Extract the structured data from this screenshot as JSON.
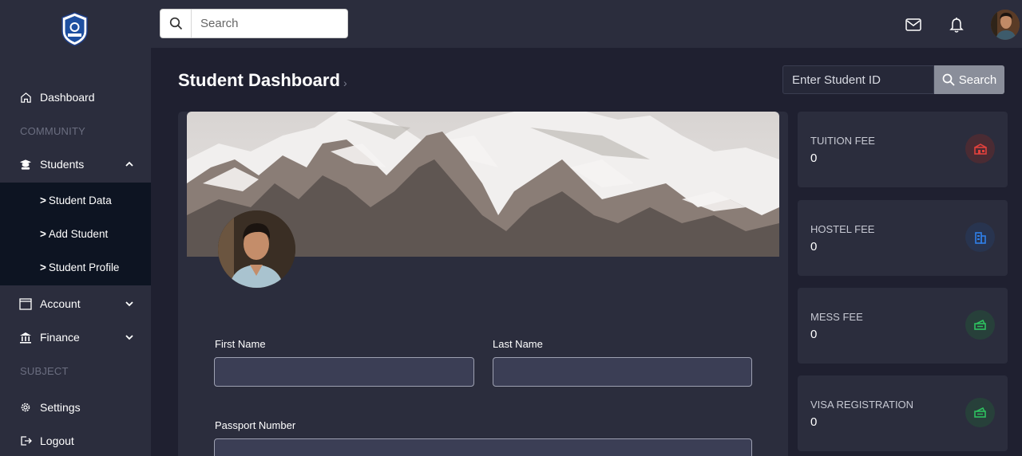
{
  "sidebar": {
    "items": {
      "dashboard": "Dashboard",
      "community": "COMMUNITY",
      "students": "Students",
      "student_data": "Student Data",
      "add_student": "Add Student",
      "student_profile": "Student Profile",
      "account": "Account",
      "finance": "Finance",
      "subject": "SUBJECT",
      "settings": "Settings",
      "logout": "Logout"
    },
    "submenu_prefix": ">"
  },
  "topbar": {
    "search_placeholder": "Search"
  },
  "main": {
    "title": "Student Dashboard",
    "title_caret": "›",
    "student_id_placeholder": "Enter Student ID",
    "search_button": "Search"
  },
  "form": {
    "first_name_label": "First Name",
    "last_name_label": "Last Name",
    "passport_label": "Passport Number"
  },
  "stats": [
    {
      "label": "TUITION FEE",
      "value": "0",
      "icon": "bank-icon",
      "color": "#e0413c",
      "bg": "#4a2b33"
    },
    {
      "label": "HOSTEL FEE",
      "value": "0",
      "icon": "building-icon",
      "color": "#2f7fe8",
      "bg": "#28344f"
    },
    {
      "label": "MESS FEE",
      "value": "0",
      "icon": "money-icon",
      "color": "#2ec15f",
      "bg": "#27403a"
    },
    {
      "label": "VISA REGISTRATION",
      "value": "0",
      "icon": "money-icon",
      "color": "#2ec15f",
      "bg": "#27403a"
    }
  ]
}
